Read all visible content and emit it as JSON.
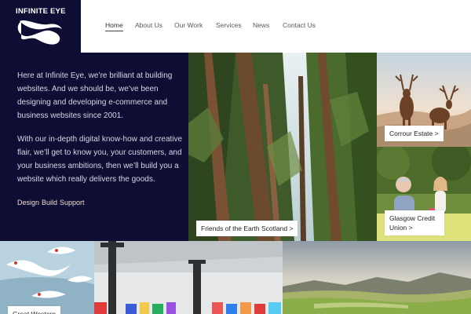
{
  "brand": {
    "name": "INFINITE EYE",
    "color": "#0e0d33",
    "accent": "#f1dfcc"
  },
  "nav": {
    "items": [
      {
        "label": "Home",
        "active": true
      },
      {
        "label": "About Us"
      },
      {
        "label": "Our Work"
      },
      {
        "label": "Services"
      },
      {
        "label": "News"
      },
      {
        "label": "Contact Us"
      }
    ]
  },
  "intro": {
    "lines_p1": [
      "Here at Infinite Eye, we’re brilliant at building",
      "websites. And we should be, we’ve been",
      "designing and developing e-commerce and",
      "business websites since 2001."
    ],
    "lines_p2": [
      "With our in-depth digital know-how and creative",
      "flair, we’ll get to know you, your customers, and",
      "your business ambitions, then we’ll build you a",
      "website which really delivers the goods."
    ],
    "services": [
      "Design",
      "Build",
      "Support"
    ]
  },
  "projects": [
    {
      "name": "forest",
      "caption": "Friends of the Earth Scotland >"
    },
    {
      "name": "deer",
      "caption": "Corrour Estate >"
    },
    {
      "name": "credit-union",
      "caption": "Glasgow Credit Union >"
    },
    {
      "name": "birds",
      "caption": "Great Western"
    },
    {
      "name": "gallery",
      "caption": ""
    },
    {
      "name": "landscape",
      "caption": ""
    }
  ]
}
